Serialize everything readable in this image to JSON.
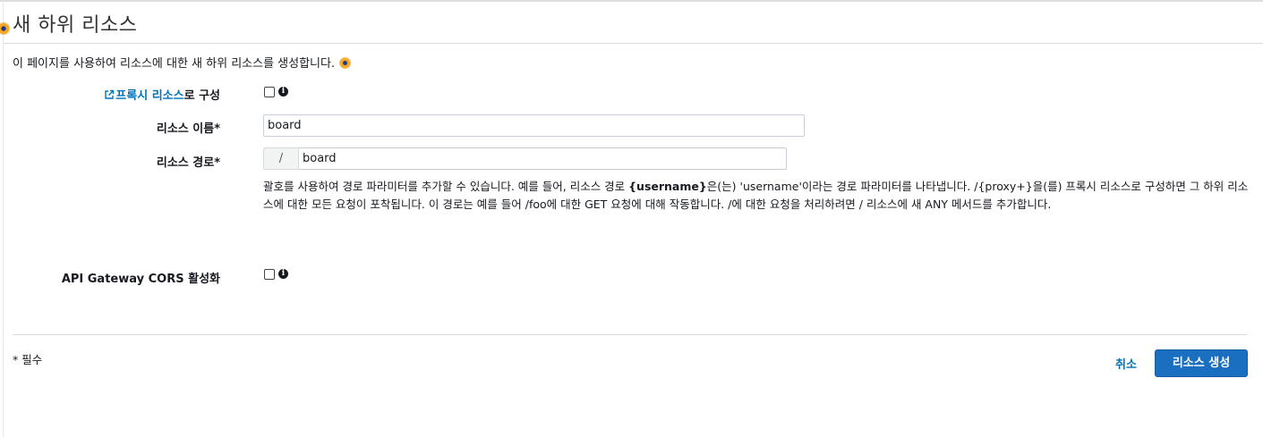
{
  "page": {
    "title": "새 하위 리소스",
    "intro": "이 페이지를 사용하여 리소스에 대한 새 하위 리소스를 생성합니다."
  },
  "form": {
    "proxy": {
      "link_text": "프록시 리소스",
      "label_suffix": "로 구성",
      "checked": false
    },
    "resource_name": {
      "label": "리소스 이름*",
      "value": "board"
    },
    "resource_path": {
      "label": "리소스 경로*",
      "prefix": "/",
      "value": "board"
    },
    "help": {
      "part1": "괄호를 사용하여 경로 파라미터를 추가할 수 있습니다. 예를 들어, 리소스 경로 ",
      "bold": "{username}",
      "part2": "은(는) 'username'이라는 경로 파라미터를 나타냅니다. /{proxy+}을(를) 프록시 리소스로 구성하면 그 하위 리소스에 대한 모든 요청이 포착됩니다. 이 경로는 예를 들어 /foo에 대한 GET 요청에 대해 작동합니다. /에 대한 요청을 처리하려면 / 리소스에 새 ANY 메서드를 추가합니다."
    },
    "cors": {
      "label": "API Gateway CORS 활성화",
      "checked": false
    }
  },
  "footer": {
    "required_note": "* 필수",
    "cancel_label": "취소",
    "create_label": "리소스 생성"
  },
  "colors": {
    "link": "#0073bb",
    "primary_button": "#1b6fc0",
    "divider": "#d5dbdb"
  },
  "icons": [
    "external-link-icon",
    "info-icon",
    "marker-dot-icon"
  ]
}
